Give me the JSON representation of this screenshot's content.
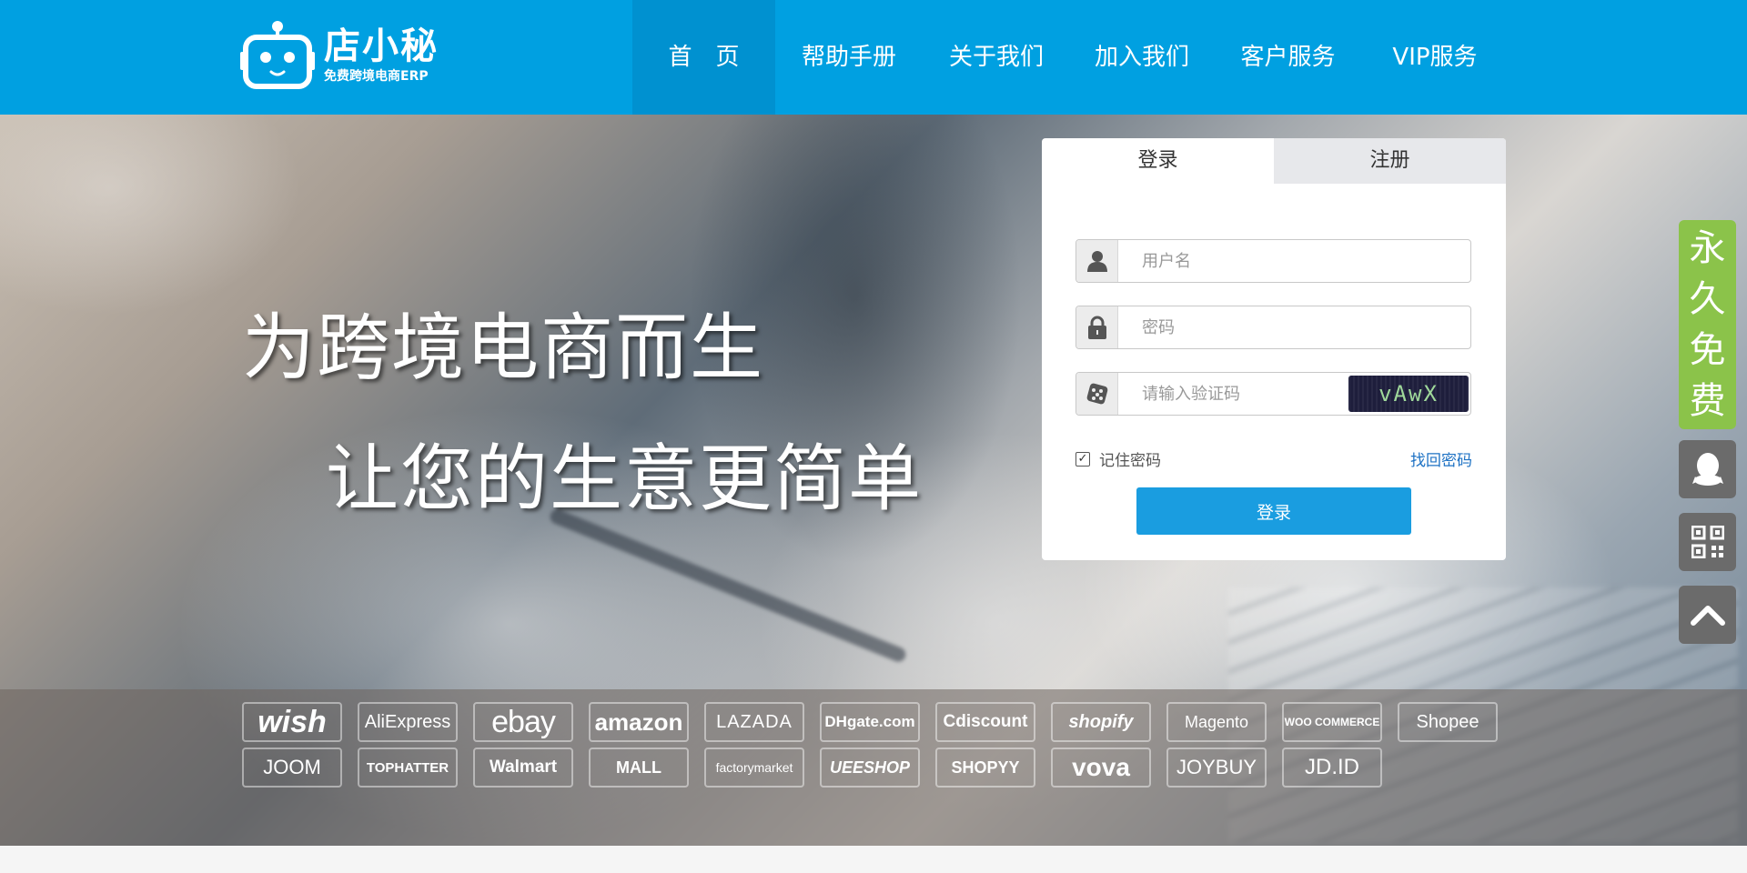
{
  "logo": {
    "name": "店小秘",
    "subtitle": "免费跨境电商ERP"
  },
  "nav": {
    "items": [
      {
        "label": "首　页",
        "active": true
      },
      {
        "label": "帮助手册",
        "active": false
      },
      {
        "label": "关于我们",
        "active": false
      },
      {
        "label": "加入我们",
        "active": false
      },
      {
        "label": "客户服务",
        "active": false
      },
      {
        "label": "VIP服务",
        "active": false
      }
    ]
  },
  "hero": {
    "slogan_line1": "为跨境电商而生",
    "slogan_line2": "让您的生意更简单"
  },
  "login": {
    "tab_login": "登录",
    "tab_register": "注册",
    "username_placeholder": "用户名",
    "password_placeholder": "密码",
    "captcha_placeholder": "请输入验证码",
    "captcha_text": "vAwX",
    "remember_label": "记住密码",
    "remember_checked": true,
    "forgot_label": "找回密码",
    "submit_label": "登录"
  },
  "platforms": {
    "row1": [
      "wish",
      "AliExpress",
      "ebay",
      "amazon",
      "LAZADA",
      "DHgate.com",
      "Cdiscount",
      "shopify",
      "Magento",
      "WOO COMMERCE",
      "Shopee"
    ],
    "row2": [
      "JOOM",
      "TOPHATTER",
      "Walmart",
      "MALL",
      "factorymarket",
      "UEESHOP",
      "SHOPYY",
      "vova",
      "JOYBUY",
      "JD.ID"
    ]
  },
  "sidebar": {
    "free_chars": [
      "永",
      "久",
      "免",
      "费"
    ],
    "free_color": "#8bc34a"
  },
  "colors": {
    "header": "#00a0e1",
    "nav_active": "#0091d0",
    "login_button": "#1a9de0",
    "link": "#1e72c4"
  }
}
